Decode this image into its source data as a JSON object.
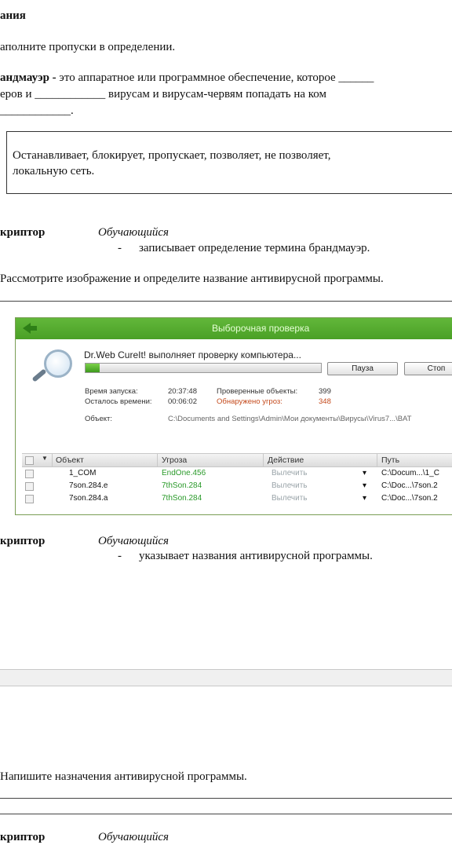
{
  "header": {
    "title": "ания"
  },
  "task1": {
    "instruction": "аполните пропуски в определении.",
    "term": "андмауэр -",
    "definition_line1": "это аппаратное или программное обеспечение, которое ______",
    "definition_line2": "еров   и   ____________   вирусам   и   вирусам-червям   попадать   на   ком",
    "definition_line3": "____________.",
    "word_bank_line1": "Останавливает,   блокирует,   пропускает,   позволяет,   не   позволяет,",
    "word_bank_line2": "локальную сеть.",
    "descriptor_label": "криптор",
    "learner_label": "Обучающийся",
    "descriptor_dash": "-",
    "descriptor_text": "записывает определение термина брандмауэр."
  },
  "task2": {
    "instruction": "Рассмотрите изображение и определите название антивирусной программы.",
    "screenshot": {
      "window_title": "Выборочная проверка",
      "status": "Dr.Web CureIt! выполняет проверку компьютера...",
      "progress_fraction": 0.06,
      "pause_button": "Пауза",
      "stop_button": "Стоп",
      "start_label": "Время запуска:",
      "start_value": "20:37:48",
      "remaining_label": "Осталось времени:",
      "remaining_value": "00:06:02",
      "checked_label": "Проверенные объекты:",
      "checked_value": "399",
      "threats_label": "Обнаружено угроз:",
      "threats_value": "348",
      "object_label": "Объект:",
      "object_path": "C:\\Documents and Settings\\Admin\\Мои документы\\Вирусы\\Virus7...\\BAT",
      "columns": [
        "Объект",
        "Угроза",
        "Действие",
        "Путь"
      ],
      "rows": [
        {
          "object": "1_COM",
          "threat": "EndOne.456",
          "action": "Вылечить",
          "path": "C:\\Docum...\\1_C"
        },
        {
          "object": "7son.284.e",
          "threat": "7thSon.284",
          "action": "Вылечить",
          "path": "C:\\Doc...\\7son.2"
        },
        {
          "object": "7son.284.a",
          "threat": "7thSon.284",
          "action": "Вылечить",
          "path": "C:\\Doc...\\7son.2"
        }
      ],
      "accent_color": "#4fa82b"
    },
    "descriptor_label": "криптор",
    "learner_label": "Обучающийся",
    "descriptor_dash": "-",
    "descriptor_text": "указывает названия антивирусной программы."
  },
  "task3": {
    "instruction": "Напишите назначения антивирусной программы.",
    "descriptor_label": "криптор",
    "learner_label": "Обучающийся"
  }
}
